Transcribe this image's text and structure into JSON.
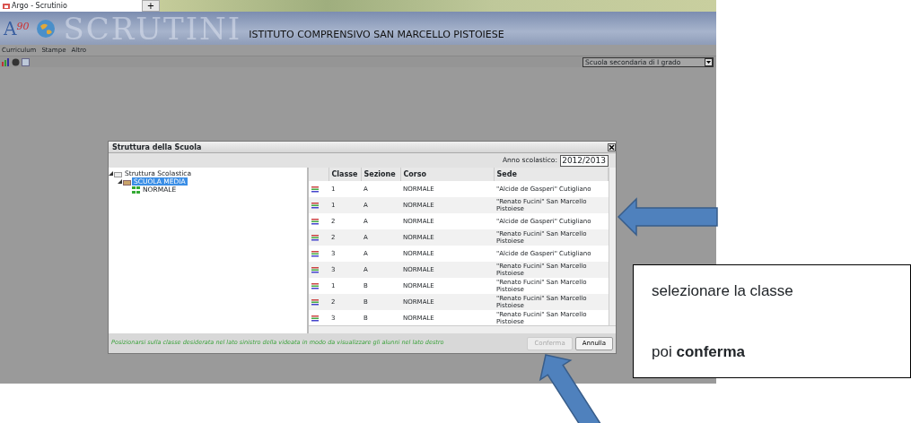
{
  "browser_tab": {
    "title": "Argo - Scrutinio",
    "new_tab": "+"
  },
  "header": {
    "logo": "A$^{90}$",
    "app_name": "SCRUTINI",
    "school": "ISTITUTO COMPRENSIVO SAN MARCELLO PISTOIESE"
  },
  "menu": [
    "Curriculum",
    "Stampe",
    "Altro"
  ],
  "school_type_select": {
    "value": "Scuola secondaria di I grado"
  },
  "dialog": {
    "title": "Struttura della Scuola",
    "year_label": "Anno scolastico:",
    "year": "2012/2013",
    "tree": [
      {
        "label": "Struttura Scolastica",
        "expanded": true,
        "selected": false,
        "children": [
          {
            "label": "SCUOLA MEDIA",
            "expanded": true,
            "selected": true,
            "children": [
              {
                "label": "NORMALE",
                "selected": false
              }
            ]
          }
        ]
      }
    ],
    "table": {
      "columns": [
        "Classe",
        "Sezione",
        "Corso",
        "Sede"
      ],
      "rows": [
        [
          "1",
          "A",
          "NORMALE",
          "\"Alcide de Gasperi\" Cutigliano"
        ],
        [
          "1",
          "A",
          "NORMALE",
          "\"Renato Fucini\" San Marcello Pistoiese"
        ],
        [
          "2",
          "A",
          "NORMALE",
          "\"Alcide de Gasperi\" Cutigliano"
        ],
        [
          "2",
          "A",
          "NORMALE",
          "\"Renato Fucini\" San Marcello Pistoiese"
        ],
        [
          "3",
          "A",
          "NORMALE",
          "\"Alcide de Gasperi\" Cutigliano"
        ],
        [
          "3",
          "A",
          "NORMALE",
          "\"Renato Fucini\" San Marcello Pistoiese"
        ],
        [
          "1",
          "B",
          "NORMALE",
          "\"Renato Fucini\" San Marcello Pistoiese"
        ],
        [
          "2",
          "B",
          "NORMALE",
          "\"Renato Fucini\" San Marcello Pistoiese"
        ],
        [
          "3",
          "B",
          "NORMALE",
          "\"Renato Fucini\" San Marcello Pistoiese"
        ]
      ]
    },
    "hint": "Posizionarsi sulla classe desiderata nel lato sinistro della videata in modo da visualizzare gli alunni nel lato destro",
    "buttons": [
      {
        "label": "Conferma",
        "disabled": true
      },
      {
        "label": "Annulla",
        "disabled": false
      }
    ]
  },
  "callout": {
    "lines": [
      "selezionare la classe",
      "poi **conferma**"
    ]
  }
}
